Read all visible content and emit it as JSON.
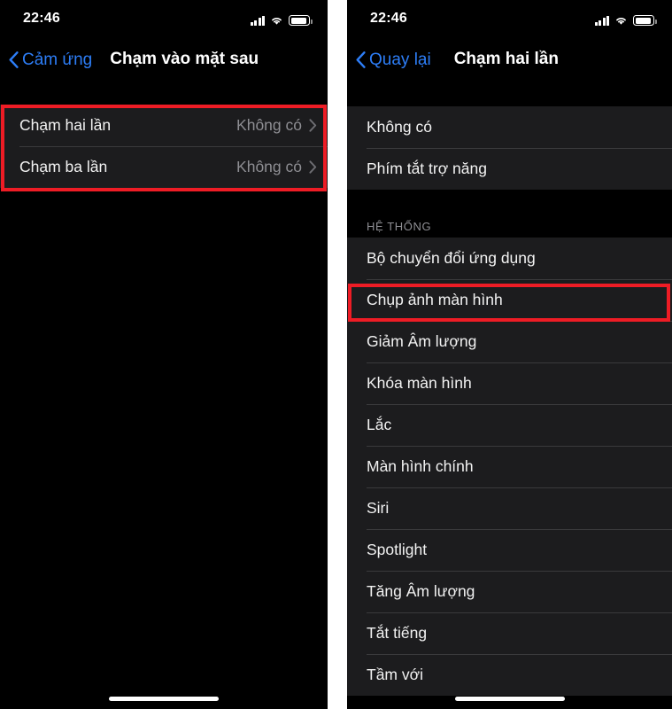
{
  "left_screen": {
    "status_bar": {
      "time": "22:46",
      "signal_icon": "cellular-signal-icon",
      "wifi_icon": "wifi-icon",
      "battery_icon": "battery-icon"
    },
    "nav": {
      "back_label": "Cảm ứng",
      "back_icon": "chevron-left-icon",
      "title": "Chạm vào mặt sau"
    },
    "rows": [
      {
        "label": "Chạm hai lần",
        "value": "Không có",
        "chevron": "chevron-right-icon"
      },
      {
        "label": "Chạm ba lần",
        "value": "Không có",
        "chevron": "chevron-right-icon"
      }
    ]
  },
  "right_screen": {
    "status_bar": {
      "time": "22:46",
      "signal_icon": "cellular-signal-icon",
      "wifi_icon": "wifi-icon",
      "battery_icon": "battery-icon"
    },
    "nav": {
      "back_label": "Quay lại",
      "back_icon": "chevron-left-icon",
      "title": "Chạm hai lần"
    },
    "group_top": [
      {
        "label": "Không có"
      },
      {
        "label": "Phím tắt trợ năng"
      }
    ],
    "section_system": {
      "header": "HỆ THỐNG",
      "rows": [
        {
          "label": "Bộ chuyển đổi ứng dụng"
        },
        {
          "label": "Chụp ảnh màn hình"
        },
        {
          "label": "Giảm Âm lượng"
        },
        {
          "label": "Khóa màn hình"
        },
        {
          "label": "Lắc"
        },
        {
          "label": "Màn hình chính"
        },
        {
          "label": "Siri"
        },
        {
          "label": "Spotlight"
        },
        {
          "label": "Tăng Âm lượng"
        },
        {
          "label": "Tắt tiếng"
        },
        {
          "label": "Tầm với"
        }
      ]
    }
  },
  "annotations": {
    "left_highlight": "highlight-box-back-tap-rows",
    "right_highlight": "highlight-box-screenshot-row"
  },
  "colors": {
    "accent_blue": "#2d7df6",
    "annotation_red": "#ee1c25",
    "row_background": "#1c1c1e",
    "page_background": "#000000",
    "secondary_text": "#8e8e93"
  }
}
